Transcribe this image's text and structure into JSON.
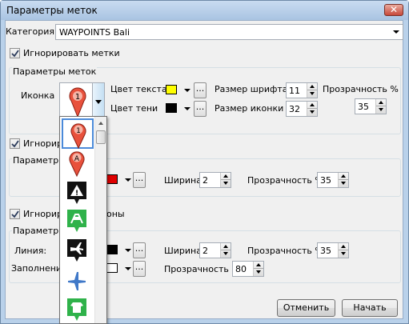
{
  "window": {
    "title": "Параметры меток",
    "close_glyph": "✕"
  },
  "category": {
    "label": "Категория:",
    "value": "WAYPOINTS Bali"
  },
  "ignore_marks": {
    "label": "Игнорировать метки",
    "checked": true
  },
  "marks_group": {
    "title": "Параметры меток",
    "icon_label": "Иконка",
    "text_color_label": "Цвет текста",
    "text_color": "#ffff00",
    "shadow_color_label": "Цвет тени",
    "shadow_color": "#000000",
    "font_size_label": "Размер шрифта",
    "font_size": "11",
    "icon_size_label": "Размер иконки",
    "icon_size": "32",
    "transparency_label": "Прозрачность %",
    "transparency": "35",
    "dots": "..."
  },
  "ignore_lines": {
    "label": "Игнориро",
    "checked": true
  },
  "lines_group": {
    "title": "Параметры",
    "color": "#e00000",
    "width_label": "Ширина",
    "width": "2",
    "transparency_label": "Прозрачность %",
    "transparency": "35",
    "dots": "..."
  },
  "ignore_polygons": {
    "label_left": "Игнориро",
    "label_right": "оны",
    "checked": true
  },
  "polygons_group": {
    "title": "Параметры",
    "line_label": "Линия:",
    "line_color": "#000000",
    "fill_label": "Заполнение",
    "fill_color": "#ffffff",
    "width_label": "Ширина",
    "width": "2",
    "line_transparency_label": "Прозрачность %",
    "line_transparency": "35",
    "fill_transparency_label": "Прозрачность %",
    "fill_transparency": "80",
    "dots": "..."
  },
  "icon_list": {
    "items": [
      {
        "icon": "red-pin-1-icon",
        "glyph": "1",
        "selected": true
      },
      {
        "icon": "red-pin-a-icon",
        "glyph": "A",
        "selected": false
      },
      {
        "icon": "warning-sign-icon",
        "glyph": "!",
        "selected": false
      },
      {
        "icon": "green-road-sign-icon",
        "glyph": "",
        "selected": false
      },
      {
        "icon": "black-airplane-sign-icon",
        "glyph": "",
        "selected": false
      },
      {
        "icon": "blue-airplane-icon",
        "glyph": "",
        "selected": false
      },
      {
        "icon": "green-shirt-sign-icon",
        "glyph": "",
        "selected": false
      }
    ]
  },
  "buttons": {
    "cancel": "Отменить",
    "start": "Начать"
  }
}
